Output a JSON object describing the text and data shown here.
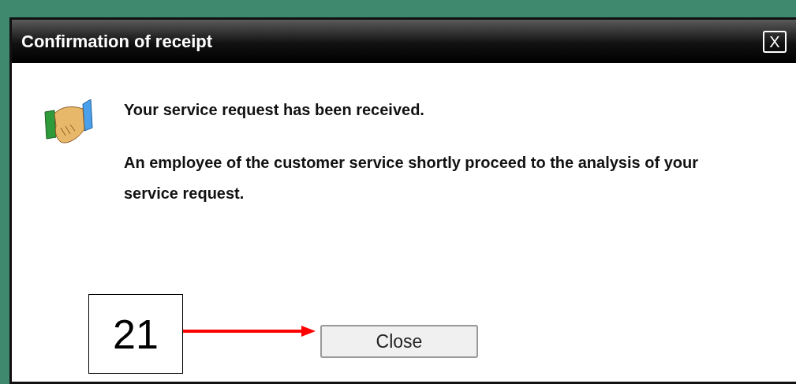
{
  "dialog": {
    "title": "Confirmation of receipt",
    "close_icon": "X",
    "messages": [
      "Your service request has been received.",
      "An employee of the customer service shortly proceed to the analysis of your service request."
    ],
    "button": "Close"
  },
  "callout": {
    "label": "21"
  }
}
